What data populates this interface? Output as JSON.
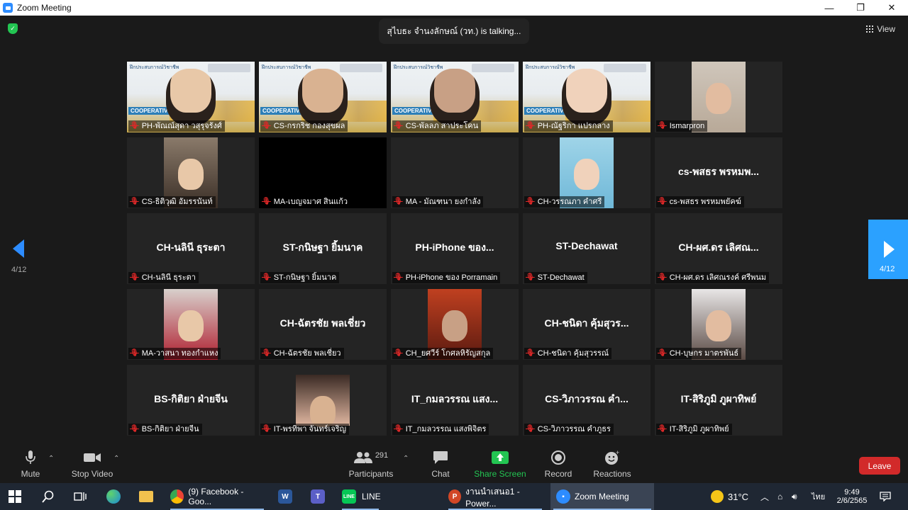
{
  "window": {
    "title": "Zoom Meeting",
    "controls": [
      "—",
      "❐",
      "✕"
    ]
  },
  "talking": "สุไบธะ จำนงลักษณ์ (วท.) is  talking...",
  "view_label": "View",
  "page": {
    "left": "4/12",
    "right": "4/12"
  },
  "tiles": [
    {
      "type": "video",
      "label": "PH-พัณณ์สุดา วสุรุจรังศ์"
    },
    {
      "type": "video",
      "label": "CS-กรกริช กองสุขผล"
    },
    {
      "type": "video",
      "label": "CS-พัลลภ สาประโคน"
    },
    {
      "type": "video",
      "label": "PH-ณัฐริกา แปรกลาง"
    },
    {
      "type": "video",
      "label": "Ismarpron"
    },
    {
      "type": "video",
      "label": "CS-ธิติวุฒิ อัมรรนันท์"
    },
    {
      "type": "black",
      "label": "MA-เบญจมาศ สินแก้ว"
    },
    {
      "type": "empty",
      "label": "MA - มัณฑนา ยงกำลัง"
    },
    {
      "type": "video",
      "label": "CH-วรรณภา คำศรี"
    },
    {
      "type": "name",
      "big": "cs-พสธร พรหมพ...",
      "label": "cs-พสธร พรหมพยัคฆ์"
    },
    {
      "type": "name",
      "big": "CH-นลินี ธุระตา",
      "label": "CH-นลินี ธุระตา"
    },
    {
      "type": "name",
      "big": "ST-กนิษฐา ยิ้มนาค",
      "label": "ST-กนิษฐา ยิ้มนาค"
    },
    {
      "type": "name",
      "big": "PH-iPhone ของ...",
      "label": "PH-iPhone ของ Porramain"
    },
    {
      "type": "name",
      "big": "ST-Dechawat",
      "label": "ST-Dechawat"
    },
    {
      "type": "name",
      "big": "CH-ผศ.ดร เลิศณ...",
      "label": "CH-ผศ.ดร เลิศณรงค์  ศรีพนม"
    },
    {
      "type": "video",
      "label": "MA-วาสนา ทองกำแหง"
    },
    {
      "type": "name",
      "big": "CH-ฉัตรชัย พลเชี่ยว",
      "label": "CH-ฉัตรชัย พลเชี่ยว"
    },
    {
      "type": "video",
      "label": "CH_ยศวีร์ โกศลหิรัญสกุล"
    },
    {
      "type": "name",
      "big": "CH-ชนิดา คุ้มสุวร...",
      "label": "CH-ชนิดา คุ้มสุวรรณ์"
    },
    {
      "type": "video",
      "label": "CH-บุษกร มาตรพันธ์"
    },
    {
      "type": "name",
      "big": "BS-กิติยา ฝ่ายจีน",
      "label": "BS-กิติยา ฝ่ายจีน"
    },
    {
      "type": "video",
      "label": "IT-พรทิพา จันทร์เจริญ"
    },
    {
      "type": "name",
      "big": "IT_กมลวรรณ แสง...",
      "label": "IT_กมลวรรณ แสงพิจิตร"
    },
    {
      "type": "name",
      "big": "CS-วิภาวรรณ คำ...",
      "label": "CS-วิภาวรรณ คำภูธร"
    },
    {
      "type": "name",
      "big": "IT-สิริภูมิ ภูผาทิพย์",
      "label": "IT-สิริภูมิ ภูผาทิพย์"
    }
  ],
  "banner": {
    "top_text": "ฝึกประสบการณ์วิชาชีพ",
    "coop": "COOPERATIVE"
  },
  "toolbar": {
    "mute": "Mute",
    "stop_video": "Stop Video",
    "participants": "Participants",
    "participants_count": "291",
    "chat": "Chat",
    "share": "Share Screen",
    "record": "Record",
    "reactions": "Reactions",
    "leave": "Leave"
  },
  "taskbar": {
    "facebook": "(9) Facebook - Goo...",
    "line": "LINE",
    "powerpoint": "งานนำเสนอ1 - Power...",
    "zoom": "Zoom Meeting",
    "temp": "31°C",
    "lang": "ไทย",
    "time": "9:49",
    "date": "2/6/2565"
  }
}
